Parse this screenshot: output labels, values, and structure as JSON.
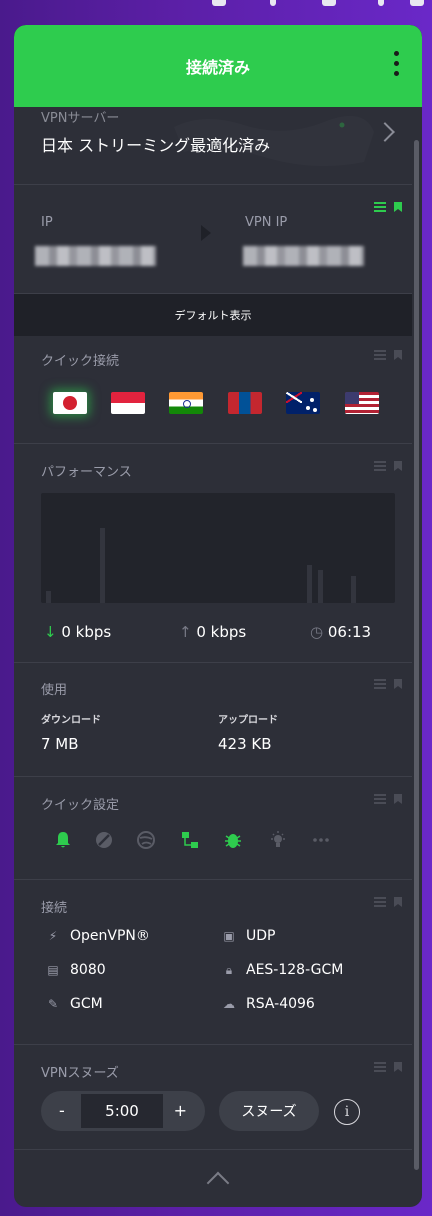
{
  "header": {
    "status": "接続済み",
    "menu_icon": "kebab-menu-icon",
    "accent": "#2ecc4e"
  },
  "server": {
    "label": "VPNサーバー",
    "name": "日本 ストリーミング最適化済み"
  },
  "ip": {
    "ip_label": "IP",
    "vpn_ip_label": "VPN IP"
  },
  "default_view": "デフォルト表示",
  "quick_connect": {
    "title": "クイック接続",
    "flags": [
      "japan-flag-icon",
      "singapore-flag-icon",
      "india-flag-icon",
      "mongolia-flag-icon",
      "australia-flag-icon",
      "united-states-flag-icon"
    ]
  },
  "performance": {
    "title": "パフォーマンス",
    "download": "0 kbps",
    "upload": "0 kbps",
    "duration": "06:13"
  },
  "usage": {
    "title": "使用",
    "download_label": "ダウンロード",
    "download_value": "7 MB",
    "upload_label": "アップロード",
    "upload_value": "423 KB"
  },
  "quick_settings": {
    "title": "クイック設定",
    "icons": [
      "bell-icon",
      "block-icon",
      "globe-icon",
      "network-icon",
      "bug-icon",
      "bulb-icon",
      "more-icon"
    ]
  },
  "connection": {
    "title": "接続",
    "protocol": "OpenVPN®",
    "transport": "UDP",
    "port": "8080",
    "cipher": "AES-128-GCM",
    "mode": "GCM",
    "key": "RSA-4096"
  },
  "snooze": {
    "title": "VPNスヌーズ",
    "minus": "-",
    "time": "5:00",
    "plus": "+",
    "button": "スヌーズ",
    "info": "i"
  }
}
